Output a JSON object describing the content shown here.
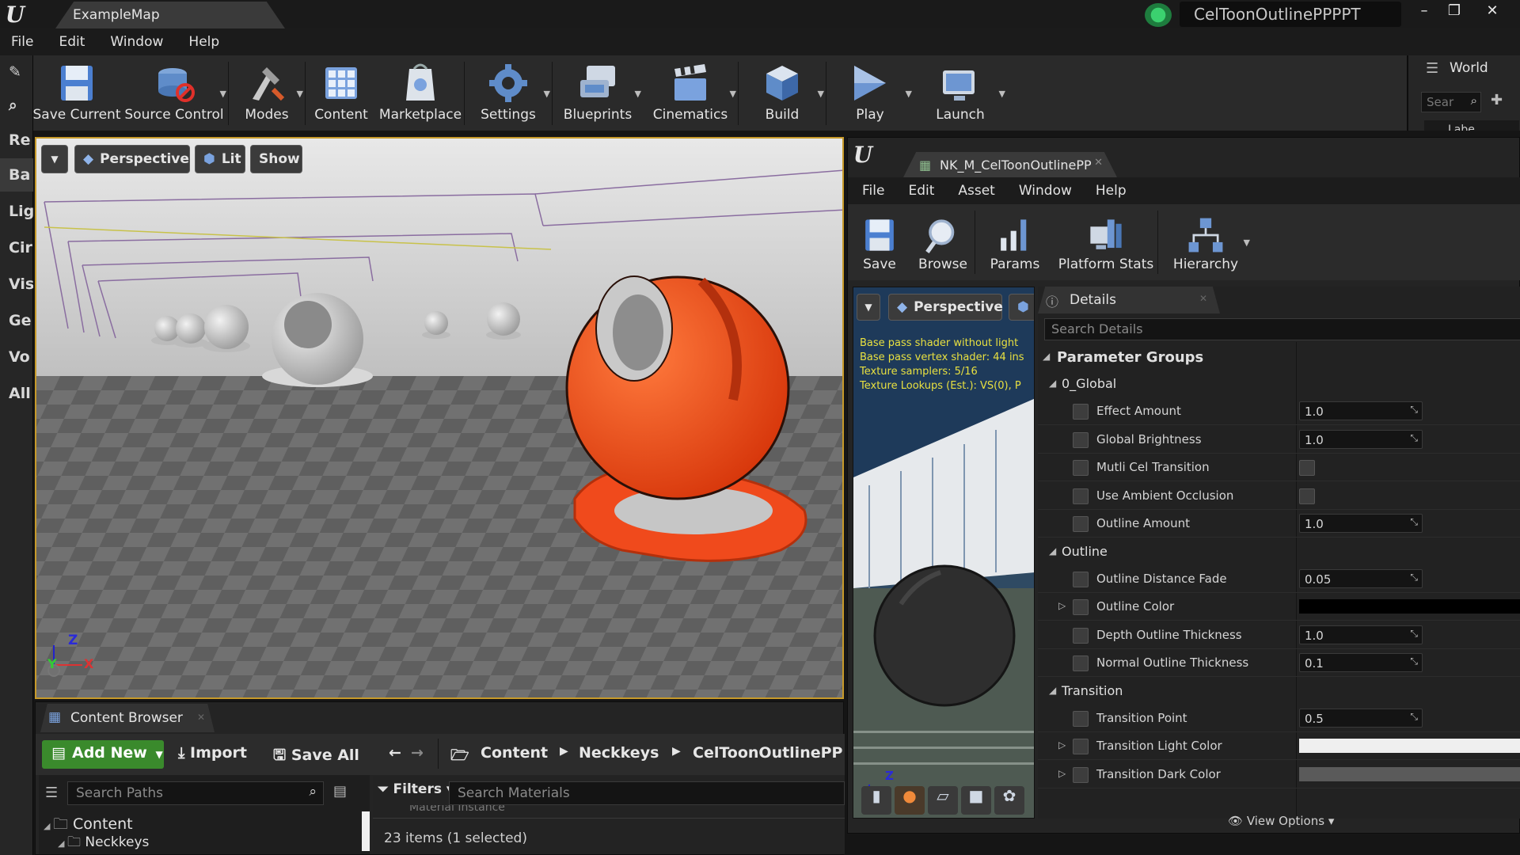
{
  "window": {
    "map_tab": "ExampleMap",
    "project_name": "CelToonOutlinePPPPT",
    "controls": [
      "–",
      "❐",
      "✕"
    ]
  },
  "menu": [
    "File",
    "Edit",
    "Window",
    "Help"
  ],
  "left_strip": [
    "Re",
    "Ba",
    "Lig",
    "Cir",
    "Vis",
    "Ge",
    "Vo",
    "All"
  ],
  "toolbar": [
    {
      "label": "Save Current",
      "icon": "save-icon"
    },
    {
      "label": "Source Control",
      "icon": "source-control-icon"
    },
    {
      "label": "Modes",
      "icon": "modes-icon"
    },
    {
      "label": "Content",
      "icon": "content-icon"
    },
    {
      "label": "Marketplace",
      "icon": "marketplace-icon"
    },
    {
      "label": "Settings",
      "icon": "settings-icon"
    },
    {
      "label": "Blueprints",
      "icon": "blueprints-icon"
    },
    {
      "label": "Cinematics",
      "icon": "cinematics-icon"
    },
    {
      "label": "Build",
      "icon": "build-icon"
    },
    {
      "label": "Play",
      "icon": "play-icon"
    },
    {
      "label": "Launch",
      "icon": "launch-icon"
    }
  ],
  "world_panel": {
    "title": "World",
    "search_placeholder": "Sear",
    "tab_fragment": "Labe"
  },
  "viewport": {
    "perspective": "Perspective",
    "lit": "Lit",
    "show": "Show",
    "axis_z": "Z",
    "axis_x": "X",
    "axis_y": "Y"
  },
  "material_editor": {
    "tab": "NK_M_CelToonOutlinePP",
    "menu": [
      "File",
      "Edit",
      "Asset",
      "Window",
      "Help"
    ],
    "toolbar": [
      {
        "label": "Save",
        "icon": "save-icon"
      },
      {
        "label": "Browse",
        "icon": "browse-icon"
      },
      {
        "label": "Params",
        "icon": "params-icon"
      },
      {
        "label": "Platform Stats",
        "icon": "platform-stats-icon"
      },
      {
        "label": "Hierarchy",
        "icon": "hierarchy-icon"
      }
    ],
    "preview": {
      "perspective": "Perspective",
      "stats": [
        "Base pass shader without light",
        "Base pass vertex shader: 44 ins",
        "Texture samplers: 5/16",
        "Texture Lookups (Est.): VS(0), P"
      ],
      "axis_z": "Z"
    },
    "details": {
      "title": "Details",
      "search_placeholder": "Search Details",
      "parameter_groups": "Parameter Groups",
      "view_options": "View Options",
      "groups": [
        {
          "name": "0_Global",
          "params": [
            {
              "label": "Effect Amount",
              "type": "number",
              "value": "1.0"
            },
            {
              "label": "Global Brightness",
              "type": "number",
              "value": "1.0"
            },
            {
              "label": "Mutli Cel Transition",
              "type": "bool"
            },
            {
              "label": "Use Ambient Occlusion",
              "type": "bool"
            },
            {
              "label": "Outline Amount",
              "type": "number",
              "value": "1.0"
            }
          ]
        },
        {
          "name": "Outline",
          "params": [
            {
              "label": "Outline Distance Fade",
              "type": "number",
              "value": "0.05"
            },
            {
              "label": "Outline Color",
              "type": "color",
              "color": "#000000"
            },
            {
              "label": "Depth Outline Thickness",
              "type": "number",
              "value": "1.0"
            },
            {
              "label": "Normal Outline Thickness",
              "type": "number",
              "value": "0.1"
            }
          ]
        },
        {
          "name": "Transition",
          "params": [
            {
              "label": "Transition Point",
              "type": "number",
              "value": "0.5"
            },
            {
              "label": "Transition Light Color",
              "type": "color",
              "color": "#efefef"
            },
            {
              "label": "Transition Dark Color",
              "type": "color",
              "color": "#5a5a5a"
            }
          ]
        }
      ]
    }
  },
  "content_browser": {
    "tab": "Content Browser",
    "add_new": "Add New",
    "import": "Import",
    "save_all": "Save All",
    "path": [
      "Content",
      "Neckkeys",
      "CelToonOutlinePP"
    ],
    "search_paths_placeholder": "Search Paths",
    "filters": "Filters",
    "search_materials_placeholder": "Search Materials",
    "tree": [
      "Content",
      "Neckkeys"
    ],
    "asset_type": "Material Instance",
    "item_count": "23 items (1 selected)"
  },
  "colors": {
    "accent_orange": "#f04a1c",
    "selection_border": "#c79a2a",
    "add_new_green": "#3a8a2c"
  }
}
